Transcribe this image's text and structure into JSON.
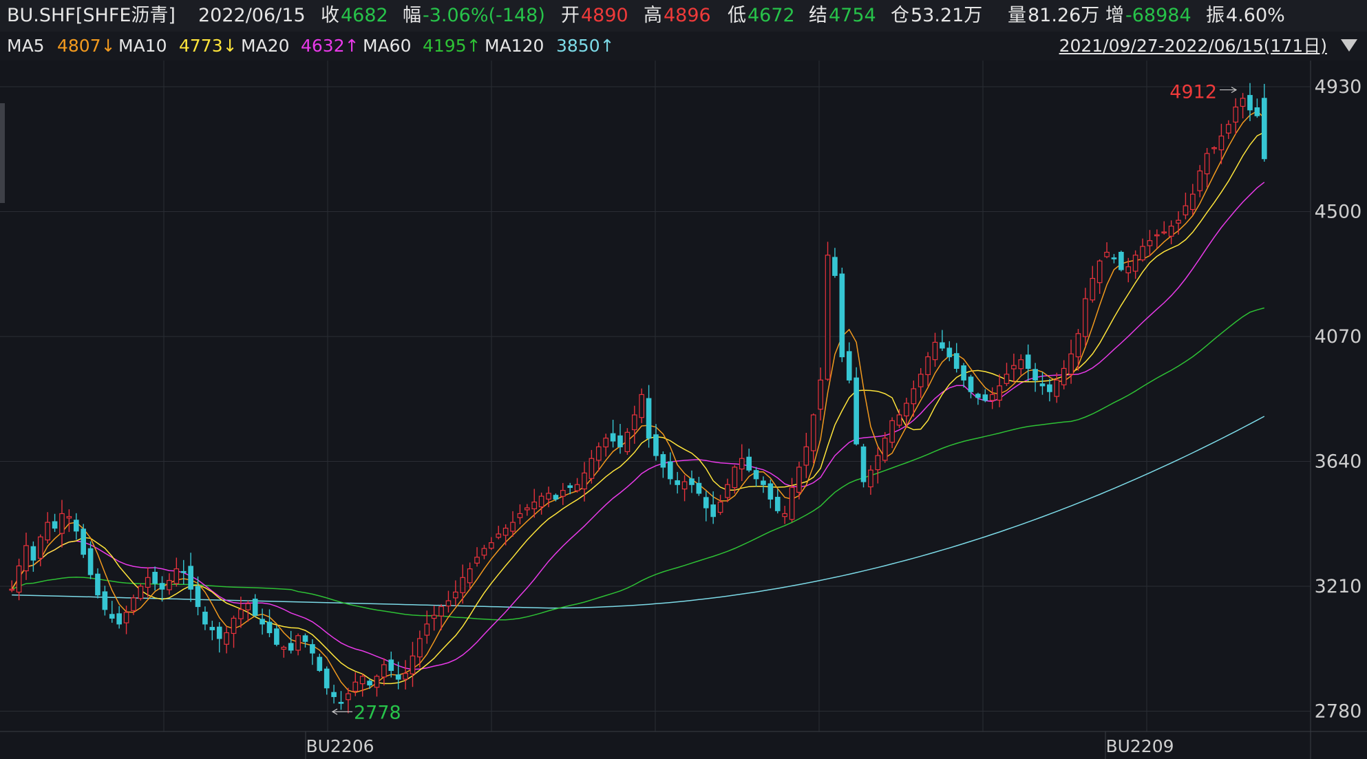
{
  "header": {
    "symbol": "BU.SHF[SHFE沥青]",
    "date": "2022/06/15",
    "close_label": "收",
    "close_value": "4682",
    "change_label": "幅",
    "change_value": "-3.06%(-148)",
    "open_label": "开",
    "open_value": "4890",
    "high_label": "高",
    "high_value": "4896",
    "low_label": "低",
    "low_value": "4672",
    "settle_label": "结",
    "settle_value": "4754",
    "position_label": "仓",
    "position_value": "53.21万",
    "volume_label": "量",
    "volume_value": "81.26万",
    "increase_label": "增",
    "increase_value": "-68984",
    "amplitude_label": "振",
    "amplitude_value": "4.60%"
  },
  "ma_bar": {
    "ma5_label": "MA5",
    "ma5_value": "4807↓",
    "ma10_label": "MA10",
    "ma10_value": "4773↓",
    "ma20_label": "MA20",
    "ma20_value": "4632↑",
    "ma60_label": "MA60",
    "ma60_value": "4195↑",
    "ma120_label": "MA120",
    "ma120_value": "3850↑",
    "range": "2021/09/27-2022/06/15(171日)"
  },
  "colors": {
    "up": "#e8323c",
    "down": "#36c6d3",
    "ma5": "#f39a1e",
    "ma10": "#ffe53b",
    "ma20": "#e93ae9",
    "ma60": "#2ec235",
    "ma120": "#7ddbe8",
    "green_text": "#27c34a",
    "red_text": "#ef3a3a",
    "grid": "#2a2d34"
  },
  "chart_data": {
    "type": "candlestick",
    "ylim": [
      2710,
      5020
    ],
    "yticks": [
      "4930",
      "4500",
      "4070",
      "3640",
      "3210",
      "2780"
    ],
    "contract_labels": [
      "BU2206",
      "BU2209"
    ],
    "max_annotation": "4912",
    "min_annotation": "2778",
    "close_sample": [
      3200,
      3280,
      3350,
      3300,
      3380,
      3430,
      3410,
      3460,
      3450,
      3400,
      3320,
      3250,
      3180,
      3130,
      3100,
      3080,
      3120,
      3170,
      3210,
      3240,
      3220,
      3200,
      3230,
      3270,
      3260,
      3200,
      3140,
      3080,
      3060,
      3030,
      3050,
      3100,
      3130,
      3150,
      3110,
      3080,
      3050,
      3010,
      3000,
      2990,
      3040,
      3020,
      2980,
      2920,
      2860,
      2830,
      2810,
      2840,
      2880,
      2900,
      2870,
      2900,
      2940,
      2920,
      2890,
      2910,
      2970,
      3030,
      3080,
      3110,
      3140,
      3160,
      3190,
      3240,
      3270,
      3310,
      3340,
      3360,
      3390,
      3410,
      3430,
      3460,
      3480,
      3500,
      3520,
      3530,
      3510,
      3540,
      3550,
      3560,
      3600,
      3650,
      3690,
      3720,
      3710,
      3690,
      3740,
      3800,
      3870,
      3720,
      3660,
      3620,
      3580,
      3560,
      3570,
      3560,
      3530,
      3480,
      3450,
      3500,
      3560,
      3620,
      3650,
      3610,
      3580,
      3560,
      3510,
      3470,
      3460,
      3550,
      3620,
      3690,
      3800,
      3920,
      4350,
      4280,
      4000,
      3920,
      3700,
      3570,
      3610,
      3660,
      3720,
      3780,
      3800,
      3840,
      3890,
      3940,
      4000,
      4050,
      4030,
      4000,
      3960,
      3920,
      3880,
      3860,
      3850,
      3870,
      3900,
      3940,
      3970,
      3990,
      3960,
      3920,
      3900,
      3880,
      3920,
      3960,
      4010,
      4080,
      4200,
      4270,
      4330,
      4360,
      4340,
      4300,
      4310,
      4350,
      4380,
      4400,
      4420,
      4430,
      4450,
      4470,
      4520,
      4560,
      4640,
      4700,
      4720,
      4760,
      4800,
      4860,
      4890,
      4850,
      4830,
      4682
    ]
  }
}
